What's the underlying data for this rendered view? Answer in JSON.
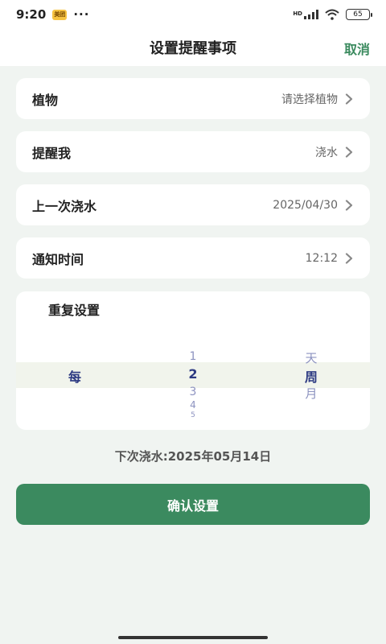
{
  "status_bar": {
    "time": "9:20",
    "app_badge": "美团",
    "dots": "···",
    "network": "HD",
    "battery": "65"
  },
  "header": {
    "title": "设置提醒事项",
    "cancel_label": "取消"
  },
  "rows": [
    {
      "label": "植物",
      "value": "请选择植物"
    },
    {
      "label": "提醒我",
      "value": "浇水"
    },
    {
      "label": "上一次浇水",
      "value": "2025/04/30"
    },
    {
      "label": "通知时间",
      "value": "12:12"
    }
  ],
  "repeat": {
    "title": "重复设置",
    "col1": {
      "selected": "每"
    },
    "col2": {
      "above": "1",
      "selected": "2",
      "below1": "3",
      "below2": "4",
      "below3": "5"
    },
    "col3": {
      "above": "天",
      "selected": "周",
      "below1": "月"
    }
  },
  "next_water": "下次浇水:2025年05月14日",
  "confirm_label": "确认设置",
  "colors": {
    "accent": "#3b8a5f",
    "background": "#f0f4f1",
    "picker_selected": "#2d3a82",
    "picker_unselected": "#8d93c0"
  },
  "icons": {
    "row_chevron": "chevron-right-icon",
    "wifi": "wifi-icon",
    "signal": "signal-icon",
    "battery": "battery-icon"
  }
}
